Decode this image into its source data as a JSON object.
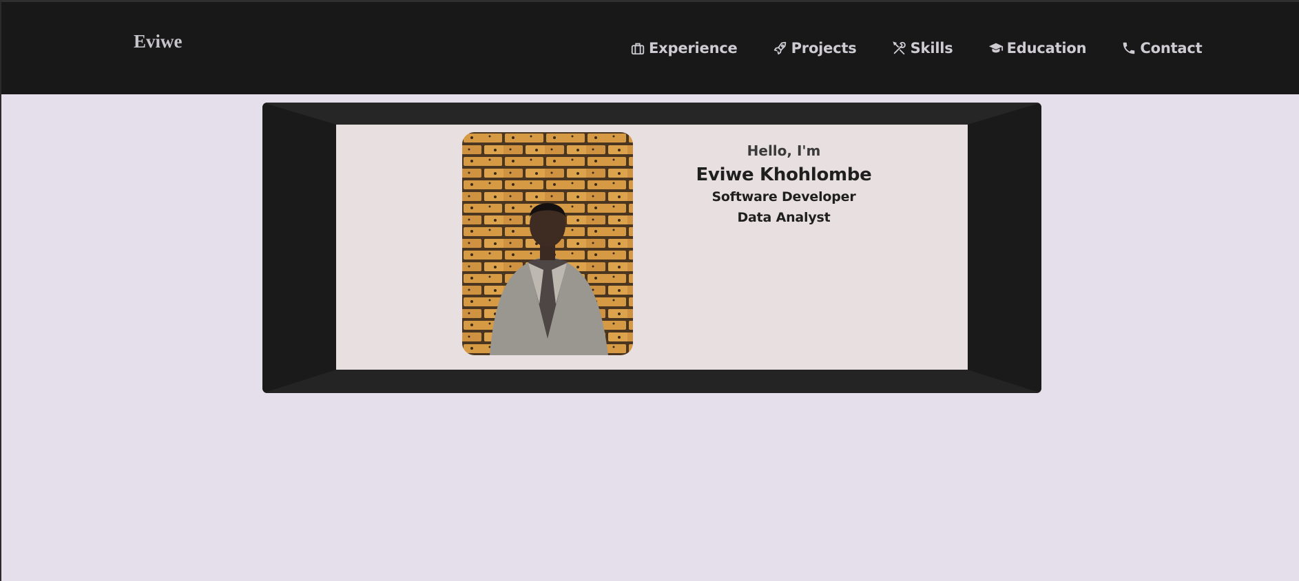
{
  "brand": "Eviwe",
  "nav": {
    "items": [
      {
        "label": "Experience",
        "icon": "briefcase-icon"
      },
      {
        "label": "Projects",
        "icon": "rocket-icon"
      },
      {
        "label": "Skills",
        "icon": "tools-icon"
      },
      {
        "label": "Education",
        "icon": "graduation-cap-icon"
      },
      {
        "label": "Contact",
        "icon": "phone-icon"
      }
    ]
  },
  "hero": {
    "greeting": "Hello, I'm",
    "name": "Eviwe Khohlombe",
    "roles": [
      "Software Developer",
      "Data Analyst"
    ],
    "portrait_icon": "profile-photo"
  },
  "colors": {
    "navbar_bg": "#181818",
    "page_bg": "#e4dfea",
    "card_bg": "#e8dfe0",
    "frame_bg": "#1b1b1b",
    "nav_text": "#cfcbd3"
  }
}
